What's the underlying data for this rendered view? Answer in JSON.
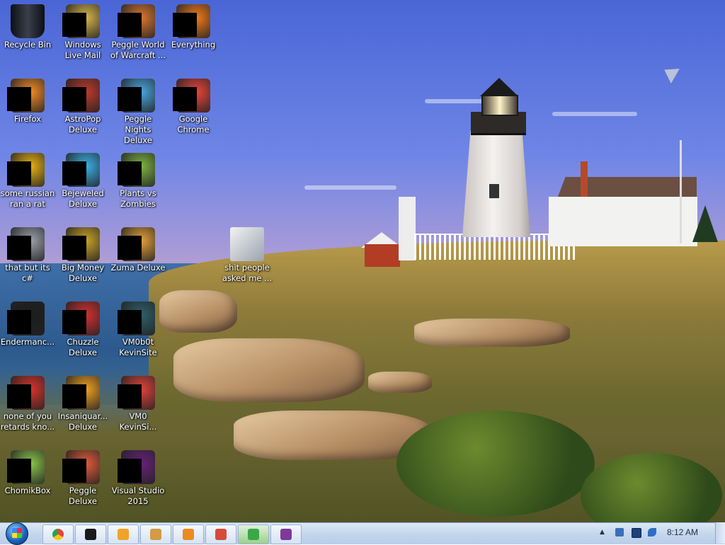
{
  "desktop": {
    "icons": [
      {
        "label": "Recycle Bin",
        "icon": "recycle-bin-icon",
        "color": "#1c1f26"
      },
      {
        "label": "Windows Live Mail",
        "icon": "mail-icon",
        "color": "#d6b44a"
      },
      {
        "label": "Peggle World of Warcraft ...",
        "icon": "peggle-icon",
        "color": "#d9762e"
      },
      {
        "label": "Everything",
        "icon": "everything-search-icon",
        "color": "#f07a1a"
      },
      {
        "label": "Firefox",
        "icon": "firefox-icon",
        "color": "#f08a24"
      },
      {
        "label": "AstroPop Deluxe",
        "icon": "astropop-icon",
        "color": "#c0392b"
      },
      {
        "label": "Peggle Nights Deluxe",
        "icon": "peggle-nights-icon",
        "color": "#4aa6e0"
      },
      {
        "label": "Google Chrome",
        "icon": "chrome-icon",
        "color": "#e8443a"
      },
      {
        "label": "some russian ran a rat",
        "icon": "document-e-icon",
        "color": "#e6b012"
      },
      {
        "label": "Bejeweled Deluxe",
        "icon": "bejeweled-icon",
        "color": "#3ab0e6"
      },
      {
        "label": "Plants vs Zombies",
        "icon": "plants-vs-zombies-icon",
        "color": "#7cb342"
      },
      {
        "label": "",
        "icon": "",
        "color": ""
      },
      {
        "label": "that but its c#",
        "icon": "stacked-windows-icon",
        "color": "#9aa0a8"
      },
      {
        "label": "Big Money Deluxe",
        "icon": "money-bag-icon",
        "color": "#c9a227"
      },
      {
        "label": "Zuma Deluxe",
        "icon": "zuma-icon",
        "color": "#e2a03a"
      },
      {
        "label": "shit people asked me ...",
        "icon": "folder-icon",
        "color": "#d9d9d9"
      },
      {
        "label": "Endermanc...",
        "icon": "terminal-icon",
        "color": "#1d1d1d"
      },
      {
        "label": "Chuzzle Deluxe",
        "icon": "chuzzle-icon",
        "color": "#d32f2f"
      },
      {
        "label": "VM0b0t KevinSite",
        "icon": "vm-shortcut-icon",
        "color": "#2f5f6a"
      },
      {
        "label": "",
        "icon": "",
        "color": ""
      },
      {
        "label": "none of you retards kno...",
        "icon": "chrome-shortcut-icon",
        "color": "#d8332c"
      },
      {
        "label": "Insaniquar... Deluxe",
        "icon": "fish-icon",
        "color": "#f0a020"
      },
      {
        "label": "VM0 KevinSi...",
        "icon": "chrome-shortcut-icon",
        "color": "#e0433a"
      },
      {
        "label": "",
        "icon": "",
        "color": ""
      },
      {
        "label": "ChomikBox",
        "icon": "chomikbox-icon",
        "color": "#8bc34a"
      },
      {
        "label": "Peggle Deluxe",
        "icon": "peggle-deluxe-icon",
        "color": "#e05a3a"
      },
      {
        "label": "Visual Studio 2015",
        "icon": "visual-studio-icon",
        "color": "#68217a"
      }
    ]
  },
  "taskbar": {
    "start_icon": "windows-start-icon",
    "pinned": [
      {
        "name": "chrome",
        "icon": "chrome-icon",
        "color": "#e8443a"
      },
      {
        "name": "terminal",
        "icon": "black-window-icon",
        "color": "#1a1a1a"
      },
      {
        "name": "media-player",
        "icon": "media-player-icon",
        "color": "#f0a32a"
      },
      {
        "name": "peggle",
        "icon": "peggle-icon",
        "color": "#d49a45"
      },
      {
        "name": "insaniquarium",
        "icon": "fish-icon",
        "color": "#ec8a22"
      },
      {
        "name": "peggle-nights",
        "icon": "peggle-nights-icon",
        "color": "#d84a3a"
      },
      {
        "name": "green-app",
        "icon": "green-globe-icon",
        "color": "#3aa84a"
      },
      {
        "name": "winrar",
        "icon": "winrar-icon",
        "color": "#7d3a9a"
      }
    ],
    "tray": {
      "clock": "8:12 AM",
      "icons": [
        "show-hidden-icons-icon",
        "network-icon",
        "display-icon",
        "volume-icon"
      ]
    }
  }
}
